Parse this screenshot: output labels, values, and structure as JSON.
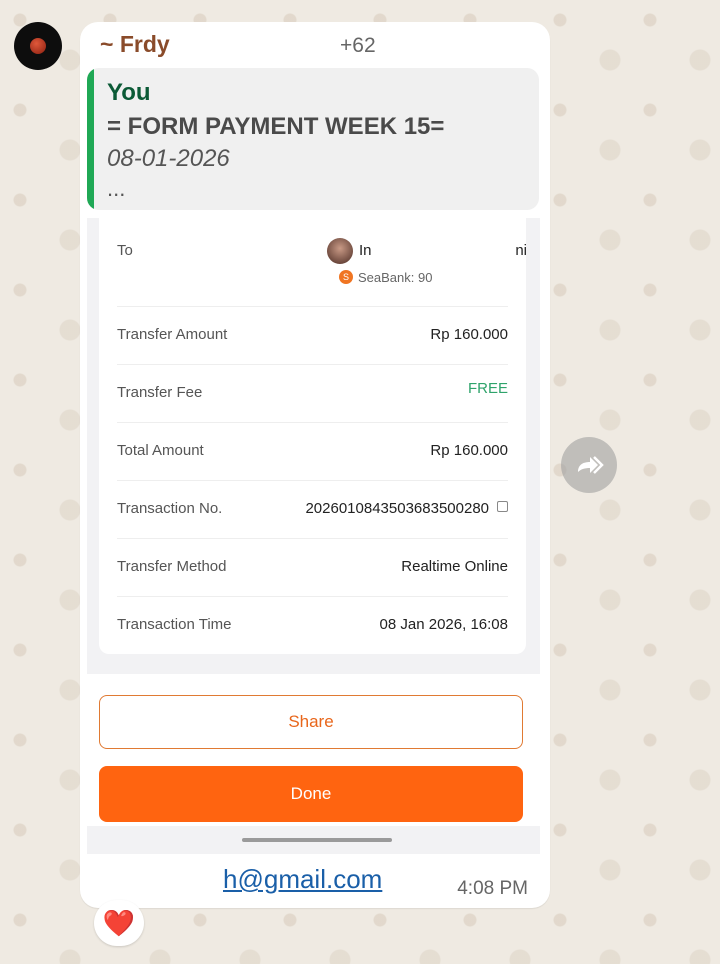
{
  "chat": {
    "sender": "~ Frdy",
    "sender_phone": "+62"
  },
  "quote": {
    "author": "You",
    "title": "= FORM PAYMENT WEEK 15=",
    "date": "08-01-2026",
    "more": "..."
  },
  "receipt": {
    "to_label": "To",
    "recipient_name_start": "In",
    "recipient_name_end": "ni",
    "recipient_bank": "SeaBank: 90",
    "rows": [
      {
        "label": "Transfer Amount",
        "value": "Rp 160.000"
      },
      {
        "label": "Transfer Fee",
        "value": "FREE"
      },
      {
        "label": "Total Amount",
        "value": "Rp 160.000"
      },
      {
        "label": "Transaction No.",
        "value": "20260108435036835002​80"
      },
      {
        "label": "Transfer Method",
        "value": "Realtime Online"
      },
      {
        "label": "Transaction Time",
        "value": "08 Jan 2026, 16:08"
      }
    ],
    "share_label": "Share",
    "done_label": "Done"
  },
  "message": {
    "email_visible": "h@gmail.com",
    "time": "4:08 PM"
  },
  "reaction": {
    "emoji": "❤️"
  },
  "colors": {
    "accent_orange": "#ff6410",
    "quote_bar_green": "#1fa855",
    "free_green": "#2fa36b"
  }
}
